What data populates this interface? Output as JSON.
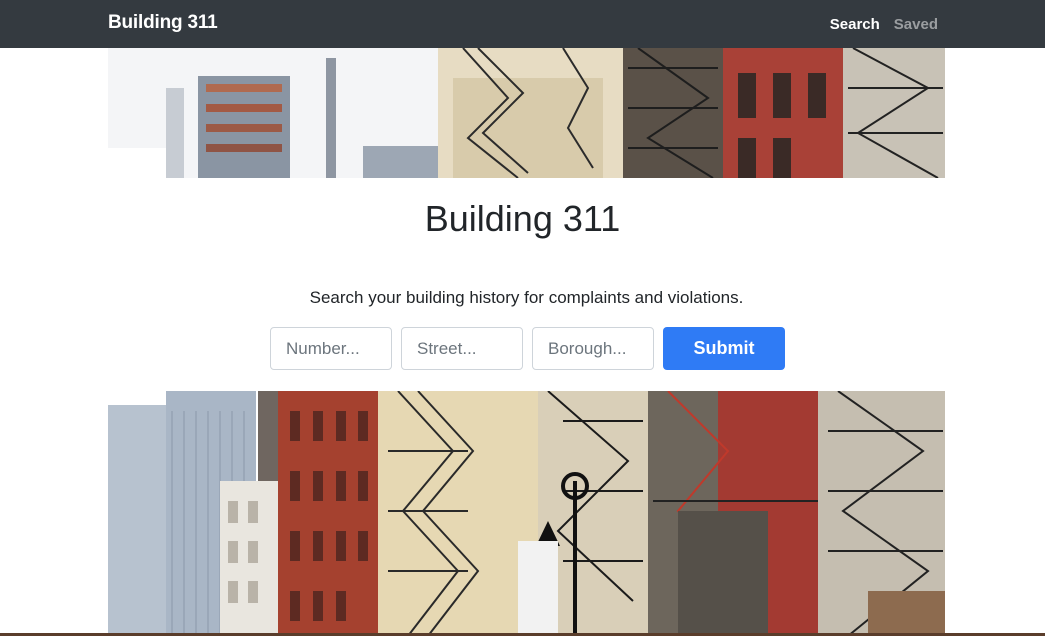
{
  "navbar": {
    "brand": "Building 311",
    "links": [
      {
        "label": "Search",
        "active": true
      },
      {
        "label": "Saved",
        "active": false
      }
    ],
    "bg_color": "#343a40"
  },
  "main": {
    "title": "Building 311",
    "subtitle": "Search your building history for complaints and violations.",
    "form": {
      "number_placeholder": "Number...",
      "street_placeholder": "Street...",
      "borough_placeholder": "Borough...",
      "submit_label": "Submit"
    },
    "accent_color": "#2f7bf5"
  },
  "images": {
    "top_banner": "nyc-buildings-fire-escapes-photo",
    "bottom_banner": "nyc-buildings-fire-escapes-photo"
  }
}
